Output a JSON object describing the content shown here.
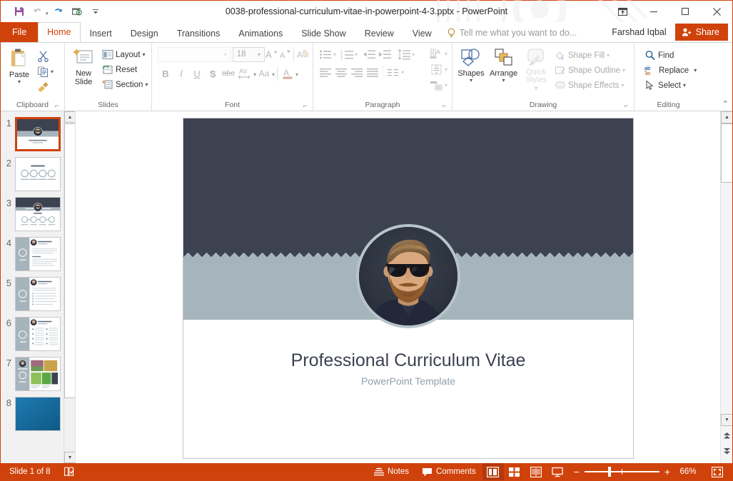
{
  "window": {
    "title": "0038-professional-curriculum-vitae-in-powerpoint-4-3.pptx - PowerPoint",
    "minimize_label": "Minimize",
    "restore_label": "Restore Down",
    "close_label": "Close",
    "ribbon_display_label": "Ribbon Display Options"
  },
  "quick_access": {
    "save": "Save",
    "undo": "Undo",
    "redo": "Repeat",
    "start_slideshow": "Start From Beginning",
    "customize": "Customize Quick Access Toolbar"
  },
  "tabs": {
    "file": "File",
    "items": [
      {
        "label": "Home",
        "active": true
      },
      {
        "label": "Insert",
        "active": false
      },
      {
        "label": "Design",
        "active": false
      },
      {
        "label": "Transitions",
        "active": false
      },
      {
        "label": "Animations",
        "active": false
      },
      {
        "label": "Slide Show",
        "active": false
      },
      {
        "label": "Review",
        "active": false
      },
      {
        "label": "View",
        "active": false
      }
    ],
    "tell_me": "Tell me what you want to do...",
    "user_name": "Farshad Iqbal",
    "share": "Share"
  },
  "ribbon": {
    "collapse_label": "Collapse the Ribbon",
    "groups": [
      {
        "name": "Clipboard",
        "label": "Clipboard",
        "paste": "Paste",
        "cut": "Cut",
        "copy": "Copy",
        "format_painter": "Format Painter"
      },
      {
        "name": "Slides",
        "label": "Slides",
        "new_slide": "New Slide",
        "layout": "Layout",
        "reset": "Reset",
        "section": "Section"
      },
      {
        "name": "Font",
        "label": "Font",
        "font_name": "",
        "font_name_placeholder": "",
        "font_size": "18",
        "increase_font": "Increase Font Size",
        "decrease_font": "Decrease Font Size",
        "clear_formatting": "Clear All Formatting",
        "bold": "B",
        "italic": "I",
        "underline": "U",
        "shadow": "S",
        "strikethrough": "abc",
        "char_spacing": "AV",
        "change_case": "Aa",
        "font_color": "A"
      },
      {
        "name": "Paragraph",
        "label": "Paragraph",
        "bullets": "Bullets",
        "numbering": "Numbering",
        "decrease_indent": "Decrease List Level",
        "increase_indent": "Increase List Level",
        "line_spacing": "Line Spacing",
        "text_direction": "Text Direction",
        "align_text": "Align Text",
        "smartart": "Convert to SmartArt",
        "align_left": "Align Left",
        "center": "Center",
        "align_right": "Align Right",
        "justify": "Justify",
        "columns": "Columns"
      },
      {
        "name": "Drawing",
        "label": "Drawing",
        "shapes": "Shapes",
        "arrange": "Arrange",
        "quick_styles": "Quick Styles",
        "shape_fill": "Shape Fill",
        "shape_outline": "Shape Outline",
        "shape_effects": "Shape Effects"
      },
      {
        "name": "Editing",
        "label": "Editing",
        "find": "Find",
        "replace": "Replace",
        "select": "Select"
      }
    ]
  },
  "thumbnails": {
    "selected": 1,
    "items": [
      {
        "number": "1",
        "kind": "title"
      },
      {
        "number": "2",
        "kind": "agenda"
      },
      {
        "number": "3",
        "kind": "profile-icons"
      },
      {
        "number": "4",
        "kind": "resume-left"
      },
      {
        "number": "5",
        "kind": "resume-bullets"
      },
      {
        "number": "6",
        "kind": "resume-two-col"
      },
      {
        "number": "7",
        "kind": "gallery"
      },
      {
        "number": "8",
        "kind": "blue"
      }
    ]
  },
  "slide": {
    "title": "Professional Curriculum Vitae",
    "subtitle": "PowerPoint Template",
    "avatar_alt": "Bearded man wearing sunglasses",
    "colors": {
      "dark": "#3c4250",
      "band": "#a6b4bc",
      "title_text": "#3c4250",
      "subtitle_text": "#8fa0ab"
    }
  },
  "status_bar": {
    "slide_counter": "Slide 1 of 8",
    "accessibility": "Accessibility Checker",
    "notes": "Notes",
    "comments": "Comments",
    "views": [
      {
        "name": "normal",
        "label": "Normal",
        "active": true
      },
      {
        "name": "slide-sorter",
        "label": "Slide Sorter",
        "active": false
      },
      {
        "name": "reading",
        "label": "Reading View",
        "active": false
      },
      {
        "name": "slide-show",
        "label": "Slide Show",
        "active": false
      }
    ],
    "zoom_out": "Zoom Out",
    "zoom_in": "Zoom In",
    "zoom_level": "66%",
    "fit_window": "Fit slide to current window"
  },
  "colors": {
    "accent": "#d0420b",
    "ribbon_bg": "#ffffff",
    "panel_bg": "#f1f1f1"
  }
}
